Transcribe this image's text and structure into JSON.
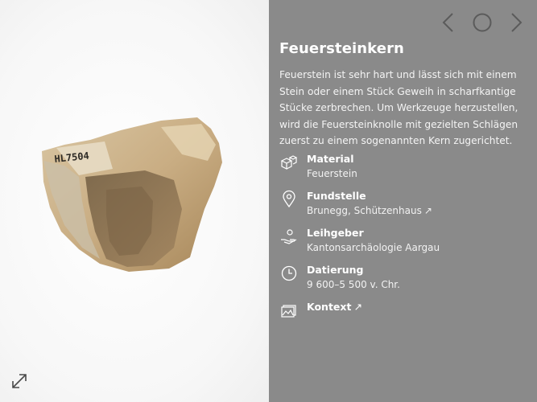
{
  "item": {
    "title": "Feuersteinkern",
    "description": "Feuerstein ist sehr hart und lässt sich mit einem Stein oder einem Stück Geweih in scharfkantige Stücke zerbrechen. Um Werkzeuge herzustellen, wird die Feuersteinknolle mit gezielten Schlägen zuerst zu einem sogenannten Kern zugerichtet.",
    "inventory_mark": "HL7504"
  },
  "facts": {
    "material": {
      "label": "Material",
      "value": "Feuerstein",
      "icon": "material-icon"
    },
    "findspot": {
      "label": "Fundstelle",
      "value": "Brunegg, Schützenhaus",
      "link_arrow": "↗",
      "icon": "location-pin-icon"
    },
    "lender": {
      "label": "Leihgeber",
      "value": "Kantonsarchäologie Aargau",
      "icon": "lender-hand-icon"
    },
    "dating": {
      "label": "Datierung",
      "value": "9 600–5 500 v. Chr.",
      "icon": "clock-icon"
    },
    "context": {
      "label": "Kontext",
      "link_arrow": "↗",
      "icon": "image-icon"
    }
  },
  "colors": {
    "info_background": "#8a8a8a",
    "text": "#ffffff",
    "image_background": "#f7f7f7"
  },
  "icons": {
    "prev": "chevron-left-icon",
    "home": "circle-icon",
    "next": "chevron-right-icon",
    "expand": "expand-diagonal-icon"
  }
}
